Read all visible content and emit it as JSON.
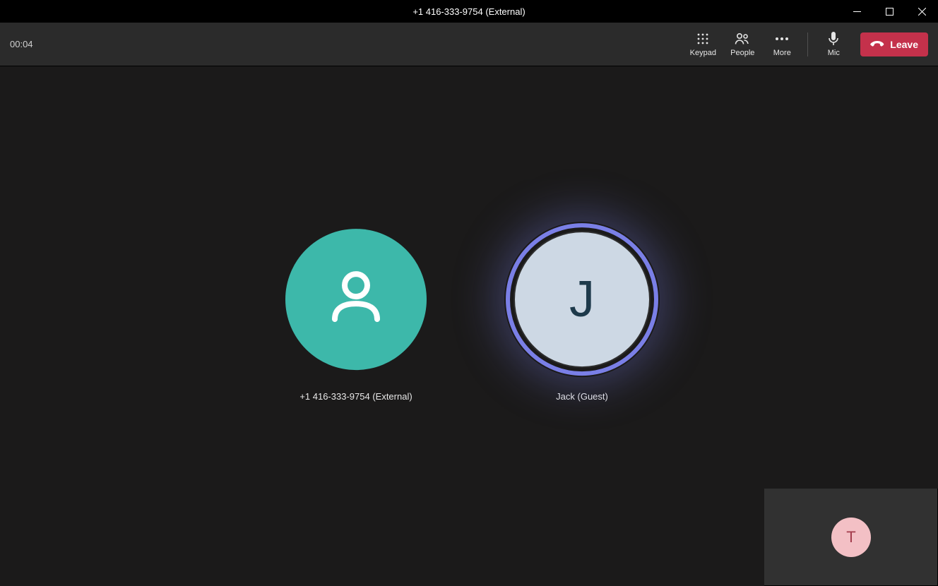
{
  "window": {
    "title": "+1 416-333-9754 (External)"
  },
  "toolbar": {
    "timer": "00:04",
    "items": {
      "keypad": "Keypad",
      "people": "People",
      "more": "More",
      "mic": "Mic"
    },
    "leave_label": "Leave"
  },
  "participants": [
    {
      "name": "+1 416-333-9754 (External)",
      "avatar_type": "generic",
      "avatar_bg": "#3db8aa",
      "speaking": false
    },
    {
      "name": "Jack (Guest)",
      "avatar_type": "initial",
      "initial": "J",
      "avatar_bg": "#cdd8e4",
      "speaking": true
    }
  ],
  "self": {
    "initial": "T",
    "avatar_bg": "#f3c0c5"
  }
}
